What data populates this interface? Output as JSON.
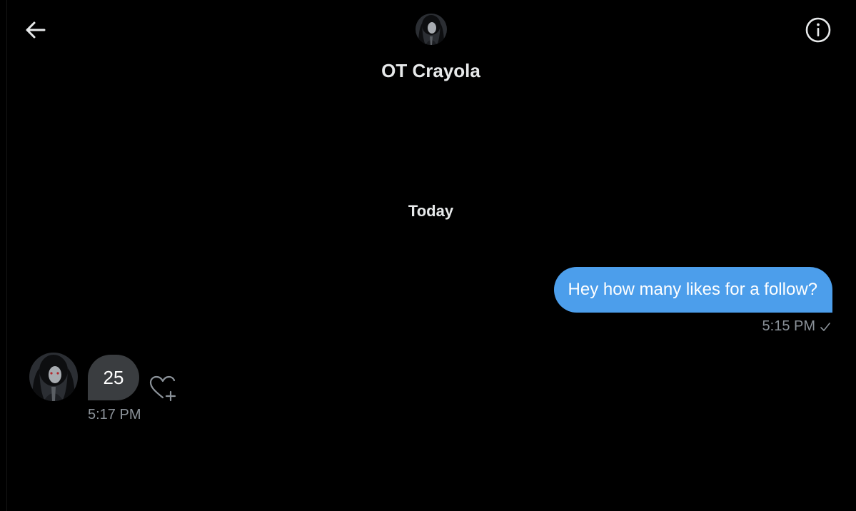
{
  "header": {
    "name": "OT Crayola",
    "back_icon": "arrow-left-icon",
    "info_icon": "info-icon",
    "avatar_icon": "avatar"
  },
  "conversation": {
    "date_separator": "Today",
    "messages": [
      {
        "direction": "outgoing",
        "text": "Hey how many likes for a follow?",
        "time": "5:15 PM",
        "status_icon": "checkmark-icon"
      },
      {
        "direction": "incoming",
        "text": "25",
        "time": "5:17 PM",
        "reaction_icon": "heart-plus-icon"
      }
    ]
  },
  "colors": {
    "background": "#000000",
    "outgoing_bubble": "#4c9eeb",
    "incoming_bubble": "#3a3d40",
    "timestamp": "#8b9299",
    "text_primary": "#e7e9ea"
  }
}
